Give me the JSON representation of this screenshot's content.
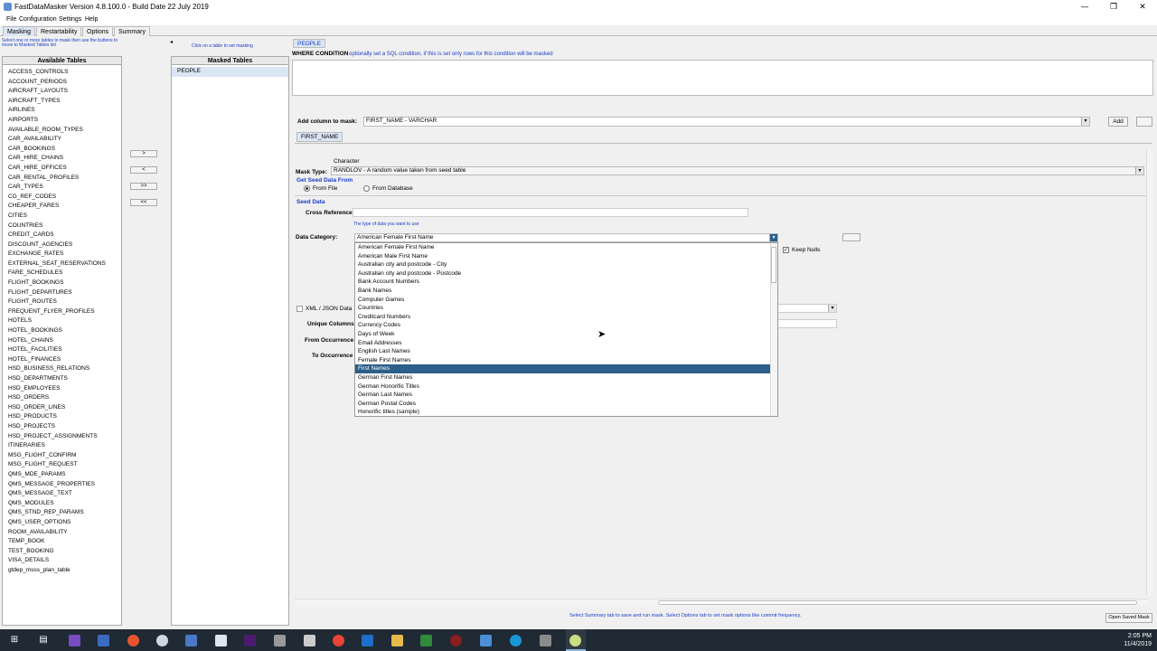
{
  "window": {
    "title": "FastDataMasker Version 4.8.100.0 - Build Date 22 July 2019",
    "controls": [
      "—",
      "❐",
      "✕"
    ]
  },
  "menu": [
    "File",
    "Configuration",
    "Settings",
    "Help"
  ],
  "tabs": [
    {
      "label": "Masking",
      "active": true
    },
    {
      "label": "Restartability",
      "active": false
    },
    {
      "label": "Options",
      "active": false
    },
    {
      "label": "Summary",
      "active": false
    }
  ],
  "left": {
    "hint": "Select one or more tables to mask then use the buttons to move to Masked Tables list",
    "header": "Available Tables",
    "tables": [
      "ACCESS_CONTROLS",
      "ACCOUNT_PERIODS",
      "AIRCRAFT_LAYOUTS",
      "AIRCRAFT_TYPES",
      "AIRLINES",
      "AIRPORTS",
      "AVAILABLE_ROOM_TYPES",
      "CAR_AVAILABILITY",
      "CAR_BOOKINGS",
      "CAR_HIRE_CHAINS",
      "CAR_HIRE_OFFICES",
      "CAR_RENTAL_PROFILES",
      "CAR_TYPES",
      "CG_REF_CODES",
      "CHEAPER_FARES",
      "CITIES",
      "COUNTRIES",
      "CREDIT_CARDS",
      "DISCOUNT_AGENCIES",
      "EXCHANGE_RATES",
      "EXTERNAL_SEAT_RESERVATIONS",
      "FARE_SCHEDULES",
      "FLIGHT_BOOKINGS",
      "FLIGHT_DEPARTURES",
      "FLIGHT_ROUTES",
      "FREQUENT_FLYER_PROFILES",
      "HOTELS",
      "HOTEL_BOOKINGS",
      "HOTEL_CHAINS",
      "HOTEL_FACILITIES",
      "HOTEL_FINANCES",
      "HSD_BUSINESS_RELATIONS",
      "HSD_DEPARTMENTS",
      "HSD_EMPLOYEES",
      "HSD_ORDERS",
      "HSD_ORDER_LINES",
      "HSD_PRODUCTS",
      "HSD_PROJECTS",
      "HSD_PROJECT_ASSIGNMENTS",
      "ITINERARIES",
      "MSG_FLIGHT_CONFIRM",
      "MSG_FLIGHT_REQUEST",
      "QMS_MDE_PARAMS",
      "QMS_MESSAGE_PROPERTIES",
      "QMS_MESSAGE_TEXT",
      "QMS_MODULES",
      "QMS_STND_REP_PARAMS",
      "QMS_USER_OPTIONS",
      "ROOM_AVAILABILITY",
      "TEMP_BOOK",
      "TEST_BOOKING",
      "VISA_DETAILS",
      "gtdep_msss_plan_table"
    ]
  },
  "move_buttons": [
    ">",
    "<",
    ">>",
    "<<"
  ],
  "masked": {
    "hint": "Click on a table to set masking",
    "header": "Masked Tables",
    "tables": [
      "PEOPLE"
    ]
  },
  "right": {
    "table_tab": "PEOPLE",
    "where_label": "WHERE CONDITION",
    "where_hint": "optionally set a SQL condition, if this is set only rows for this condition will be masked",
    "add_column_label": "Add column to mask:",
    "add_column_value": "FIRST_NAME - VARCHAR",
    "add_button": "Add",
    "column_tab": "FIRST_NAME",
    "col_type": "Character",
    "mask_type_label": "Mask Type:",
    "mask_type_value": "RANDLOV - A random value taken from seed table",
    "seed_from_label": "Get Seed Data From",
    "from_file": "From File",
    "from_database": "From Database",
    "seed_data_label": "Seed Data",
    "cross_ref_label": "Cross Reference",
    "data_type_hint": "The type of data you want to use",
    "data_category_label": "Data Category:",
    "data_category_value": "American Female First Name",
    "keep_nulls": "Keep Nulls",
    "xml_json": "XML / JSON Data",
    "unique_columns": "Unique Columns",
    "from_occurrence": "From Occurrence",
    "to_occurrence": "To Occurrence"
  },
  "dropdown": {
    "items": [
      "American Female First Name",
      "American Male First Name",
      "Australian city and postcode - City",
      "Australian city and postcode - Postcode",
      "Bank Account Numbers",
      "Bank Names",
      "Computer Games",
      "Countries",
      "Creditcard Numbers",
      "Currency Codes",
      "Days of Week",
      "Email Addresses",
      "English Last Names",
      "Female First Names",
      "First Names",
      "German First Names",
      "German Honorific Titles",
      "German Last Names",
      "German Postal Codes",
      "Honorific titles (sample)"
    ],
    "selected_index": 14
  },
  "status": {
    "text": "Select Summary tab to save and run mask.   Select Options tab to set mask options like commit frequency.",
    "open_saved_mask": "Open Saved Mask"
  },
  "taskbar": {
    "time": "2:05 PM",
    "date": "11/4/2019"
  },
  "colors": {
    "accent": "#1a3ccc",
    "selection": "#2c5f8a",
    "taskbar": "#1f2a34"
  }
}
